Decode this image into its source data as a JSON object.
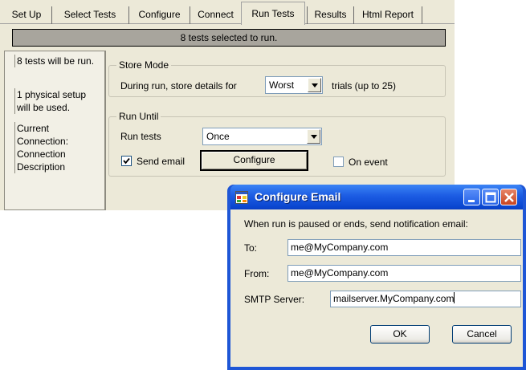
{
  "tabs": [
    {
      "label": "Set Up"
    },
    {
      "label": "Select Tests"
    },
    {
      "label": "Configure"
    },
    {
      "label": "Connect"
    },
    {
      "label": "Run Tests"
    },
    {
      "label": "Results"
    },
    {
      "label": "Html Report"
    }
  ],
  "status": "8 tests selected to run.",
  "left_panel": {
    "summary_tests": "8 tests will be run.",
    "summary_setup": "1 physical setup will be used.",
    "connection_label": "Current Connection:",
    "connection_desc": "Connection Description"
  },
  "store_mode": {
    "title": "Store Mode",
    "prefix": "During run, store details for",
    "selected": "Worst",
    "suffix": "trials (up to 25)"
  },
  "run_until": {
    "title": "Run Until",
    "run_tests_label": "Run tests",
    "run_tests_value": "Once",
    "send_email_label": "Send email",
    "send_email_checked": true,
    "configure_label": "Configure",
    "on_event_label": "On event",
    "on_event_checked": false
  },
  "dialog": {
    "title": "Configure Email",
    "instruction": "When run is paused or ends, send notification email:",
    "to_label": "To:",
    "to_value": "me@MyCompany.com",
    "from_label": "From:",
    "from_value": "me@MyCompany.com",
    "smtp_label": "SMTP Server:",
    "smtp_value": "mailserver.MyCompany.com",
    "ok_label": "OK",
    "cancel_label": "Cancel"
  },
  "colors": {
    "titlebar": "#0a46d0",
    "status_bar": "#a8a59d",
    "window_bg": "#ece9d8"
  }
}
